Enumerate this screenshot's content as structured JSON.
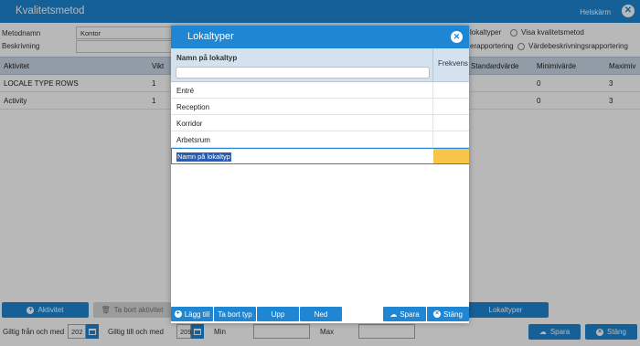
{
  "window": {
    "title": "Kvalitetsmetod",
    "fullscreen_label": "Helskärm",
    "close_glyph": "✕"
  },
  "form": {
    "method_label": "Metodnamn",
    "method_value": "Kontor",
    "description_label": "Beskrivning",
    "radio_1": "lokaltyper",
    "radio_2": "Visa kvalitetsmetod",
    "radio_3": "erapportering",
    "radio_4": "Värdebeskrivningsrapportering"
  },
  "table": {
    "columns": {
      "activity": "Aktivitet",
      "weight": "Vikt",
      "standard": "Standardvärde",
      "min": "Minimivärde",
      "max": "Maximiv"
    },
    "rows": [
      {
        "activity": "LOCALE TYPE ROWS",
        "weight": "1",
        "min": "0",
        "max": "3"
      },
      {
        "activity": "Activity",
        "weight": "1",
        "min": "0",
        "max": "3"
      }
    ]
  },
  "bottom": {
    "add_activity": "Aktivitet",
    "remove_activity": "Ta bort aktivitet",
    "locale_types": "Lokaltyper",
    "valid_from_label": "Giltig från och med",
    "valid_from_value": "202",
    "valid_to_label": "Giltig till och med",
    "valid_to_value": "209",
    "min_label": "Min",
    "max_label": "Max",
    "save": "Spara",
    "close": "Stäng"
  },
  "dialog": {
    "title": "Lokaltyper",
    "col_name": "Namn på lokaltyp",
    "col_freq": "Frekvens",
    "rows": [
      "Entré",
      "Reception",
      "Korridor",
      "Arbetsrum"
    ],
    "edit_placeholder": "Namn på lokaltyp",
    "buttons": {
      "add": "Lägg till",
      "remove": "Ta bort typ",
      "up": "Upp",
      "down": "Ned",
      "save": "Spara",
      "close": "Stäng"
    }
  },
  "colors": {
    "primary": "#1f86d3",
    "header_bg": "#c9d9e8",
    "highlight": "#f7c54a"
  }
}
